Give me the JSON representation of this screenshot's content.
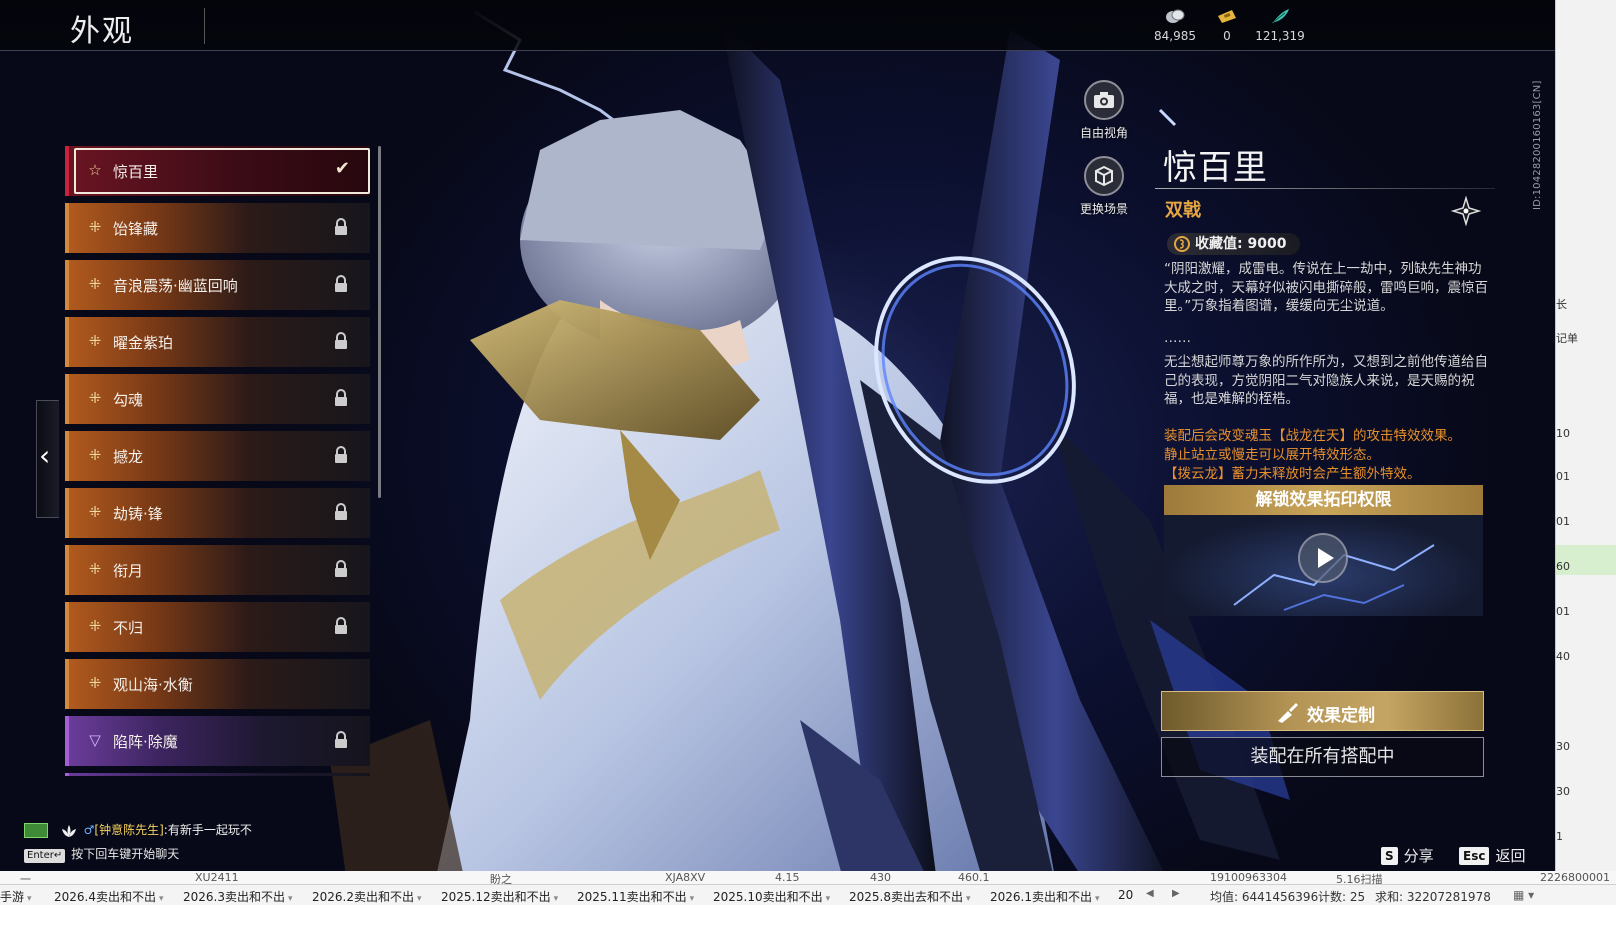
{
  "header": {
    "title": "外观",
    "currencies": [
      {
        "icon": "silver-coin-icon",
        "value": "84,985"
      },
      {
        "icon": "ticket-icon",
        "value": "0"
      },
      {
        "icon": "feather-icon",
        "value": "121,319"
      }
    ]
  },
  "skin_list": {
    "items": [
      {
        "label": "惊百里",
        "status": "selected"
      },
      {
        "label": "饴锋藏",
        "status": "locked"
      },
      {
        "label": "音浪震荡·幽蓝回响",
        "status": "locked"
      },
      {
        "label": "曜金紫珀",
        "status": "locked"
      },
      {
        "label": "勾魂",
        "status": "locked"
      },
      {
        "label": "撼龙",
        "status": "locked"
      },
      {
        "label": "劫铸·锋",
        "status": "locked"
      },
      {
        "label": "衔月",
        "status": "locked"
      },
      {
        "label": "不归",
        "status": "locked"
      },
      {
        "label": "观山海·水衡",
        "status": "unlocked"
      },
      {
        "label": "陷阵·除魔",
        "status": "locked"
      }
    ]
  },
  "camera_buttons": {
    "free_view": "自由视角",
    "change_scene": "更换场景"
  },
  "detail": {
    "name": "惊百里",
    "weapon_type": "双戟",
    "collect_label": "收藏值: 9000",
    "desc_1": "“阴阳激耀，成雷电。传说在上一劫中，列缺先生神功大成之时，天幕好似被闪电撕碎般，雷鸣巨响，震惊百里。”万象指着图谱，缓缓向无尘说道。",
    "desc_ellipsis": "……",
    "desc_2": "无尘想起师尊万象的所作所为，又想到之前他传道给自己的表现，方觉阴阳二气对隐族人来说，是天赐的祝福，也是难解的桎梏。",
    "effect_1": "装配后会改变魂玉【战龙在天】的攻击特效效果。",
    "effect_2": "静止站立或慢走可以展开特效形态。",
    "effect_3": "【拨云龙】蓄力未释放时会产生额外特效。",
    "unlock_label": "解锁效果拓印权限",
    "custom_button": "效果定制",
    "equip_button": "装配在所有搭配中"
  },
  "chat": {
    "speaker": "[钟意陈先生]",
    "message": ":有新手一起玩不",
    "enter_key": "Enter↵",
    "hint": "按下回车键开始聊天"
  },
  "hints": {
    "share_key": "S",
    "share_label": "分享",
    "back_key": "Esc",
    "back_label": "返回"
  },
  "overlay_id": "ID:10428200160163[CN]",
  "spreadsheet": {
    "row_cells": [
      "一",
      "XU2411",
      "盼之",
      "XJA8XV",
      "4.15",
      "430",
      "460.1",
      "19100963304",
      "5.16扫描",
      "2226800001"
    ],
    "right_cells": [
      "长",
      "记单",
      "10",
      "01",
      "01",
      "60",
      "01",
      "40",
      "30",
      "30",
      "1"
    ],
    "tabs": [
      "手游",
      "2026.4卖出和不出",
      "2026.3卖出和不出",
      "2026.2卖出和不出",
      "2025.12卖出和不出",
      "2025.11卖出和不出",
      "2025.10卖出和不出",
      "2025.8卖出去和不出",
      "2026.1卖出和不出",
      "20"
    ],
    "avg": "均值: 6441456396",
    "count": "计数: 25",
    "sum": "求和: 32207281978"
  },
  "colors": {
    "accent_gold": "#e5a542",
    "effect_orange": "#e7902c",
    "selected_red": "#c8233a",
    "item_orange": "#d38b3b",
    "item_purple": "#a45ed6"
  }
}
